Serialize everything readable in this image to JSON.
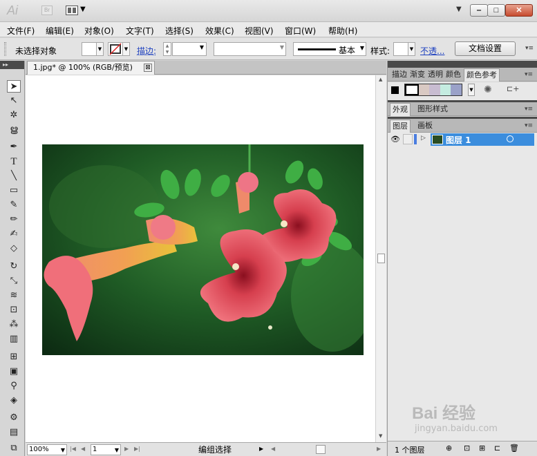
{
  "titlebar": {
    "app_logo": "Ai",
    "bridge_label": "Br",
    "window_buttons": {
      "minimize": "‒",
      "maximize": "□",
      "close": "✕"
    }
  },
  "menu": {
    "items": [
      "文件(F)",
      "编辑(E)",
      "对象(O)",
      "文字(T)",
      "选择(S)",
      "效果(C)",
      "视图(V)",
      "窗口(W)",
      "帮助(H)"
    ]
  },
  "control": {
    "selection_status": "未选择对象",
    "stroke_label": "描边:",
    "brush_label": "基本",
    "style_label": "样式:",
    "opacity_link": "不透...",
    "doc_setup_button": "文档设置"
  },
  "document": {
    "tab_title": "1.jpg* @ 100% (RGB/预览)",
    "close_glyph": "⊠"
  },
  "status": {
    "zoom": "100%",
    "artboard_number": "1",
    "tool_status": "编组选择"
  },
  "panels": {
    "top_tabs": [
      "描边",
      "渐变",
      "透明",
      "颜色",
      "颜色参考"
    ],
    "mid_tabs": [
      "外观",
      "图形样式"
    ],
    "layer_tabs": [
      "图层",
      "画板"
    ],
    "layer_name": "图层 1",
    "layer_count": "1 个图层"
  },
  "watermark": {
    "brand": "Bai 经验",
    "url": "jingyan.baidu.com"
  },
  "colors": {
    "accent_selection": "#3b8ddd",
    "link_blue": "#1c3fbf",
    "close_button": "#c74b2f",
    "layer_color": "#4a7de0"
  },
  "icons": {
    "tools": [
      "selection-arrow-icon",
      "direct-select-icon",
      "magic-wand-icon",
      "lasso-icon",
      "pen-icon",
      "type-icon",
      "line-icon",
      "rectangle-icon",
      "paintbrush-icon",
      "pencil-icon",
      "blob-brush-icon",
      "eraser-icon",
      "rotate-icon",
      "scale-icon",
      "warp-icon",
      "free-transform-icon",
      "symbol-sprayer-icon",
      "graph-icon",
      "mesh-icon",
      "gradient-icon",
      "eyedropper-icon",
      "blend-icon",
      "symbol-icon",
      "column-graph-icon",
      "artboard-icon"
    ]
  }
}
